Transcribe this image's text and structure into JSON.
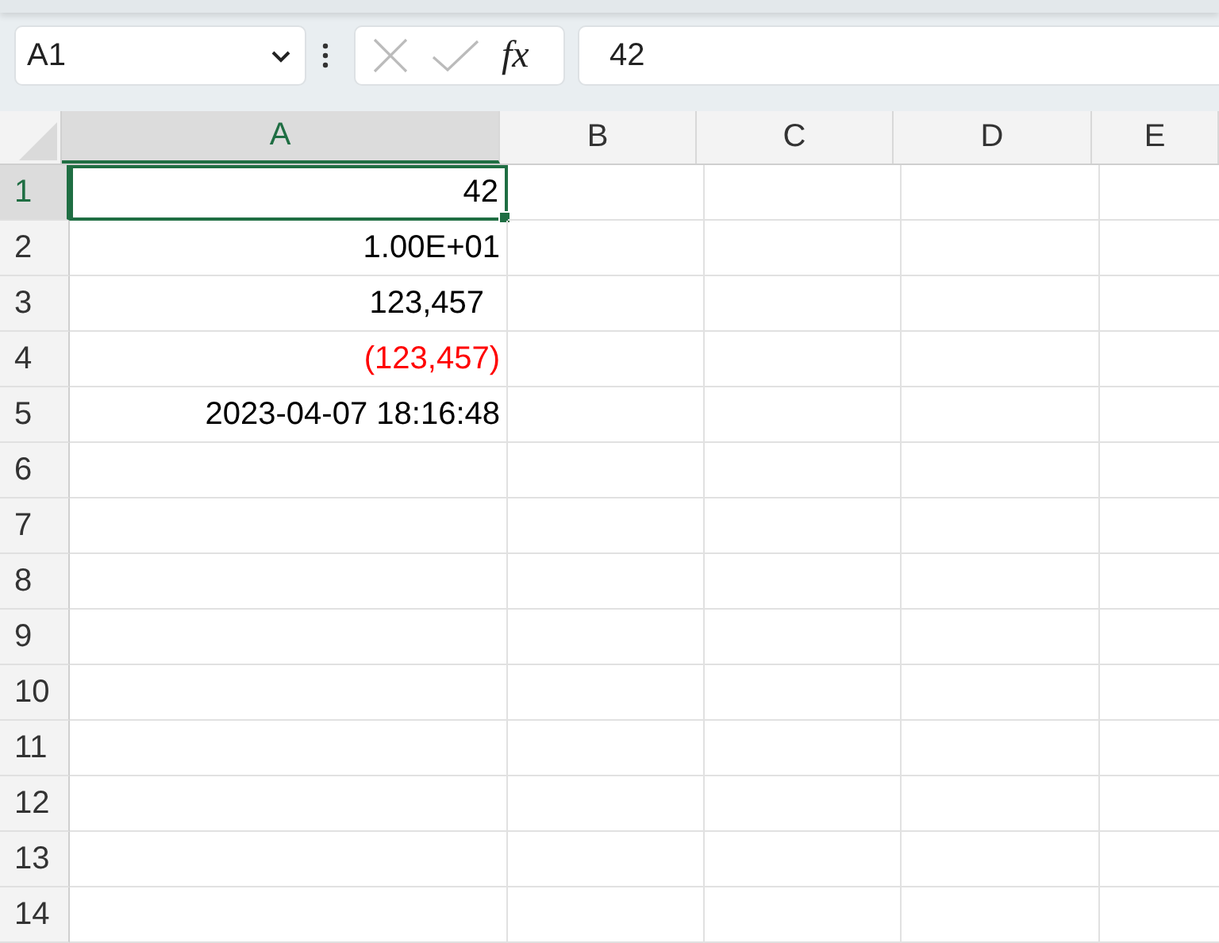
{
  "formula_bar": {
    "name_box": "A1",
    "function_button": "fx",
    "formula": "42"
  },
  "columns": [
    {
      "label": "A",
      "selected": true
    },
    {
      "label": "B",
      "selected": false
    },
    {
      "label": "C",
      "selected": false
    },
    {
      "label": "D",
      "selected": false
    },
    {
      "label": "E",
      "selected": false
    }
  ],
  "rows": [
    {
      "label": "1",
      "selected": true,
      "cells": [
        {
          "text": "42",
          "kind": "number",
          "color": "#000000",
          "selected": true
        }
      ]
    },
    {
      "label": "2",
      "selected": false,
      "cells": [
        {
          "text": "1.00E+01",
          "kind": "number",
          "color": "#000000",
          "selected": false
        }
      ]
    },
    {
      "label": "3",
      "selected": false,
      "cells": [
        {
          "text": "123,457",
          "kind": "accounting",
          "color": "#000000",
          "selected": false
        }
      ]
    },
    {
      "label": "4",
      "selected": false,
      "cells": [
        {
          "text": "(123,457)",
          "kind": "number",
          "color": "#ff0000",
          "selected": false
        }
      ]
    },
    {
      "label": "5",
      "selected": false,
      "cells": [
        {
          "text": "2023-04-07 18:16:48",
          "kind": "number",
          "color": "#000000",
          "selected": false
        }
      ]
    },
    {
      "label": "6",
      "selected": false,
      "cells": []
    },
    {
      "label": "7",
      "selected": false,
      "cells": []
    },
    {
      "label": "8",
      "selected": false,
      "cells": []
    },
    {
      "label": "9",
      "selected": false,
      "cells": []
    },
    {
      "label": "10",
      "selected": false,
      "cells": []
    },
    {
      "label": "11",
      "selected": false,
      "cells": []
    },
    {
      "label": "12",
      "selected": false,
      "cells": []
    },
    {
      "label": "13",
      "selected": false,
      "cells": []
    },
    {
      "label": "14",
      "selected": false,
      "cells": []
    }
  ]
}
